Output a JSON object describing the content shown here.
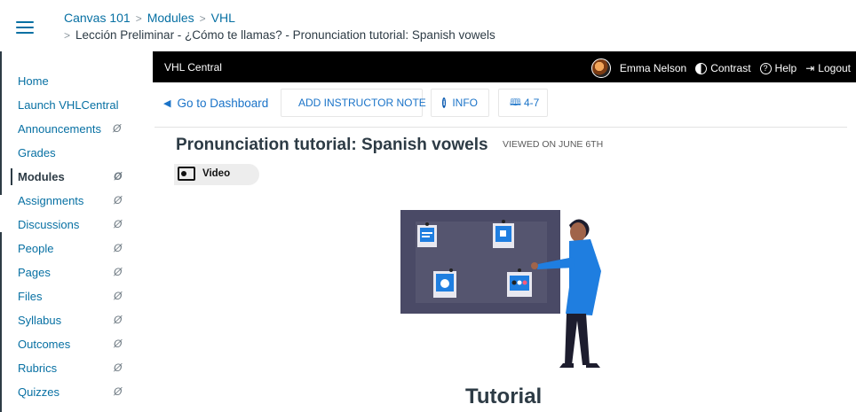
{
  "breadcrumbs": {
    "items": [
      "Canvas 101",
      "Modules",
      "VHL"
    ],
    "sub": "Lección Preliminar - ¿Cómo te llamas? - Pronunciation tutorial: Spanish vowels",
    "sep": ">"
  },
  "sidenav": {
    "hidden_icon": "Ø",
    "items": [
      {
        "label": "Home"
      },
      {
        "label": "Launch VHLCentral"
      },
      {
        "label": "Announcements"
      },
      {
        "label": "Grades"
      },
      {
        "label": "Modules"
      },
      {
        "label": "Assignments"
      },
      {
        "label": "Discussions"
      },
      {
        "label": "People"
      },
      {
        "label": "Pages"
      },
      {
        "label": "Files"
      },
      {
        "label": "Syllabus"
      },
      {
        "label": "Outcomes"
      },
      {
        "label": "Rubrics"
      },
      {
        "label": "Quizzes"
      }
    ]
  },
  "vhl": {
    "brand": "VHL Central",
    "user": "Emma Nelson",
    "contrast": "Contrast",
    "help": "Help",
    "logout": "Logout",
    "help_icon": "?",
    "logout_icon": "⇥"
  },
  "toolbar": {
    "dashboard": "Go to Dashboard",
    "dashboard_icon": "◀",
    "note": "ADD INSTRUCTOR NOTE",
    "info": "INFO",
    "info_icon": "i",
    "pages": "4-7",
    "book_icon": "🕮"
  },
  "content": {
    "title": "Pronunciation tutorial: Spanish vowels",
    "viewed": "VIEWED ON JUNE 6TH",
    "tab": "Video",
    "heading": "Tutorial"
  },
  "colors": {
    "link": "#0770a3",
    "text": "#2d3b45",
    "vhl_bar": "#000000",
    "board": "#4a4a66",
    "accent": "#1f7ee0"
  }
}
